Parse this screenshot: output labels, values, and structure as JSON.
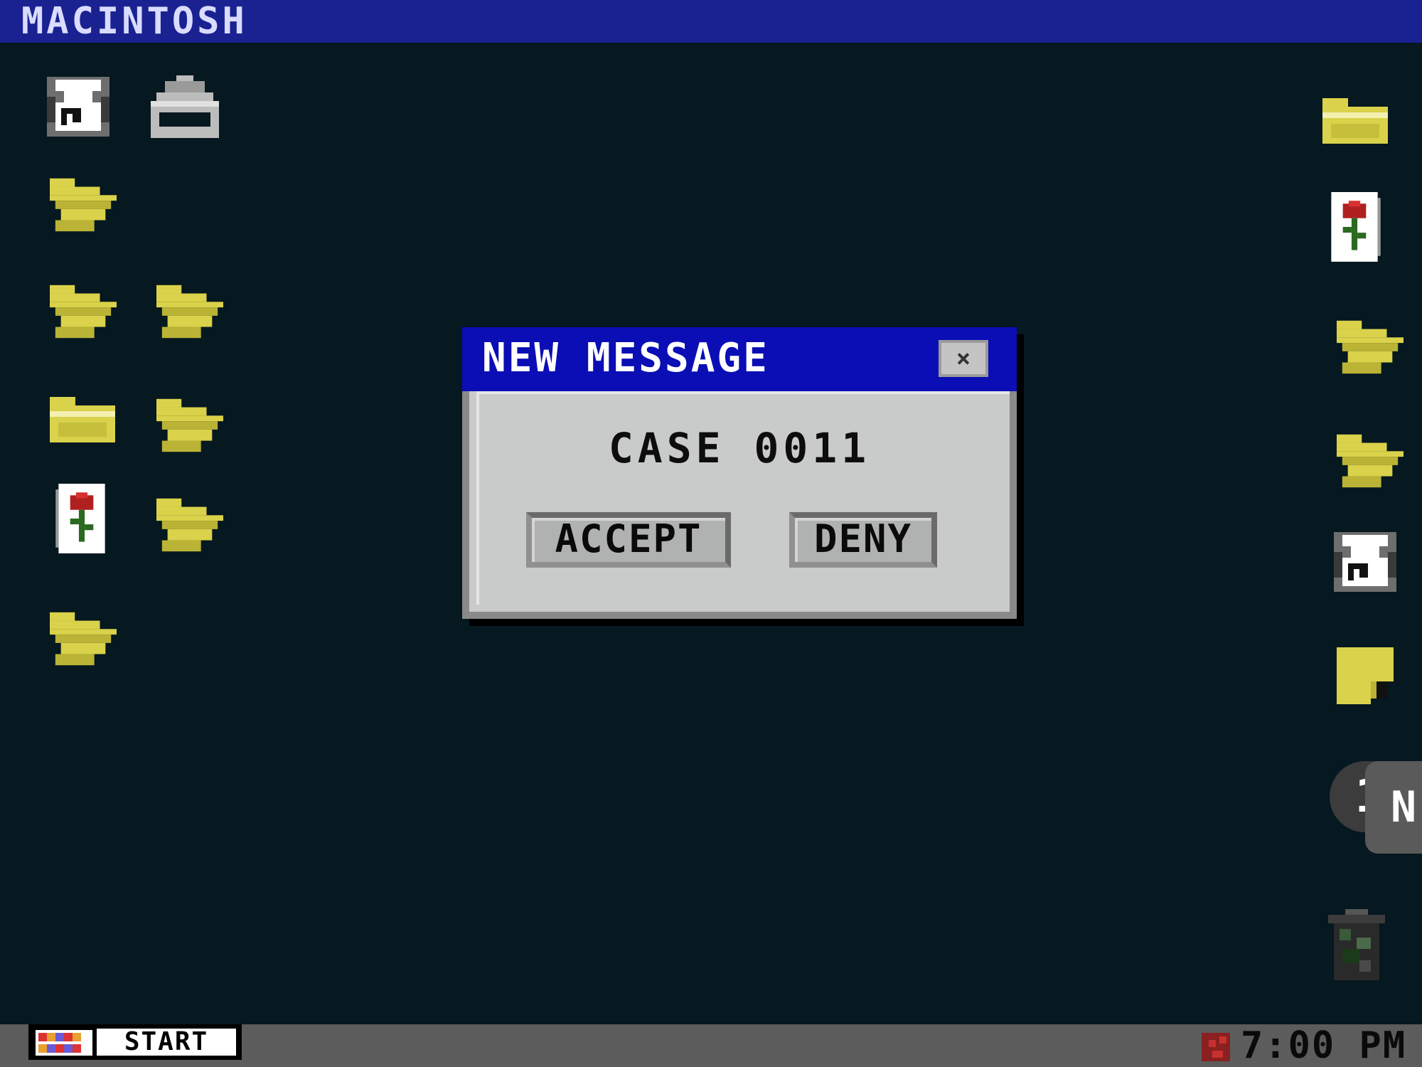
{
  "menubar": {
    "title": "MACINTOSH"
  },
  "desktop": {
    "left_icons": [
      {
        "name": "cat-icon"
      },
      {
        "name": "printer-icon"
      },
      {
        "name": "folder-icon"
      },
      {
        "name": "folder-icon"
      },
      {
        "name": "folder-icon"
      },
      {
        "name": "closed-folder-icon"
      },
      {
        "name": "folder-icon"
      },
      {
        "name": "rose-card-icon"
      },
      {
        "name": "folder-icon"
      },
      {
        "name": "folder-icon"
      }
    ],
    "right_icons": [
      {
        "name": "closed-folder-icon"
      },
      {
        "name": "rose-card-icon"
      },
      {
        "name": "folder-icon"
      },
      {
        "name": "folder-icon"
      },
      {
        "name": "cat-icon"
      },
      {
        "name": "sticky-note-icon"
      },
      {
        "name": "trash-icon"
      }
    ],
    "notification_badge": "1",
    "side_tab_label": "N"
  },
  "dialog": {
    "title": "NEW MESSAGE",
    "close_label": "×",
    "message": "CASE 0011",
    "accept_label": "ACCEPT",
    "deny_label": "DENY"
  },
  "taskbar": {
    "start_label": "START",
    "clock": "7:00 PM"
  },
  "colors": {
    "desktop": "#061820",
    "menubar": "#1a2292",
    "dialog_title": "#0a0eb4",
    "folder": "#d9d24a",
    "taskbar": "#5c5c5c"
  }
}
